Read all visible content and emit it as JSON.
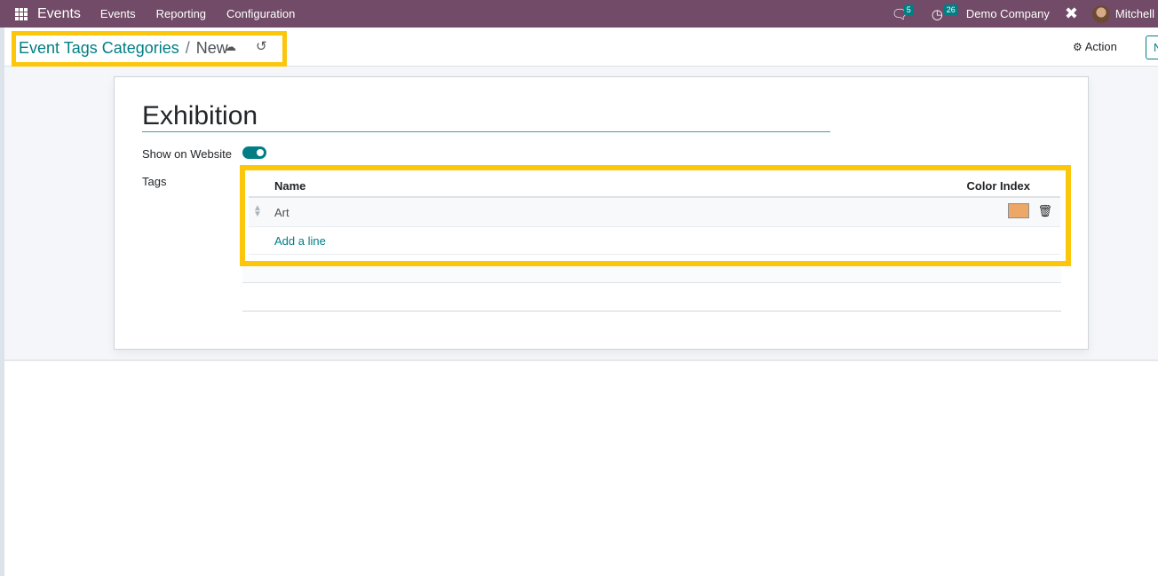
{
  "navbar": {
    "app_name": "Events",
    "menu": [
      "Events",
      "Reporting",
      "Configuration"
    ],
    "messages_count": "5",
    "activities_count": "26",
    "company": "Demo Company",
    "user": "Mitchell"
  },
  "control_panel": {
    "breadcrumb_parent": "Event Tags Categories",
    "breadcrumb_separator": "/",
    "breadcrumb_current": "New",
    "action_label": "Action",
    "new_label": "N"
  },
  "form": {
    "title": "Exhibition",
    "show_on_website_label": "Show on Website",
    "show_on_website": true,
    "tags_label": "Tags",
    "tags_table": {
      "columns": [
        "Name",
        "Color Index"
      ],
      "rows": [
        {
          "name": "Art",
          "color": "#eda766"
        }
      ],
      "add_line_label": "Add a line"
    }
  },
  "colors": {
    "navbar": "#714b67",
    "accent": "#017e84",
    "highlight": "#fcc60a"
  }
}
